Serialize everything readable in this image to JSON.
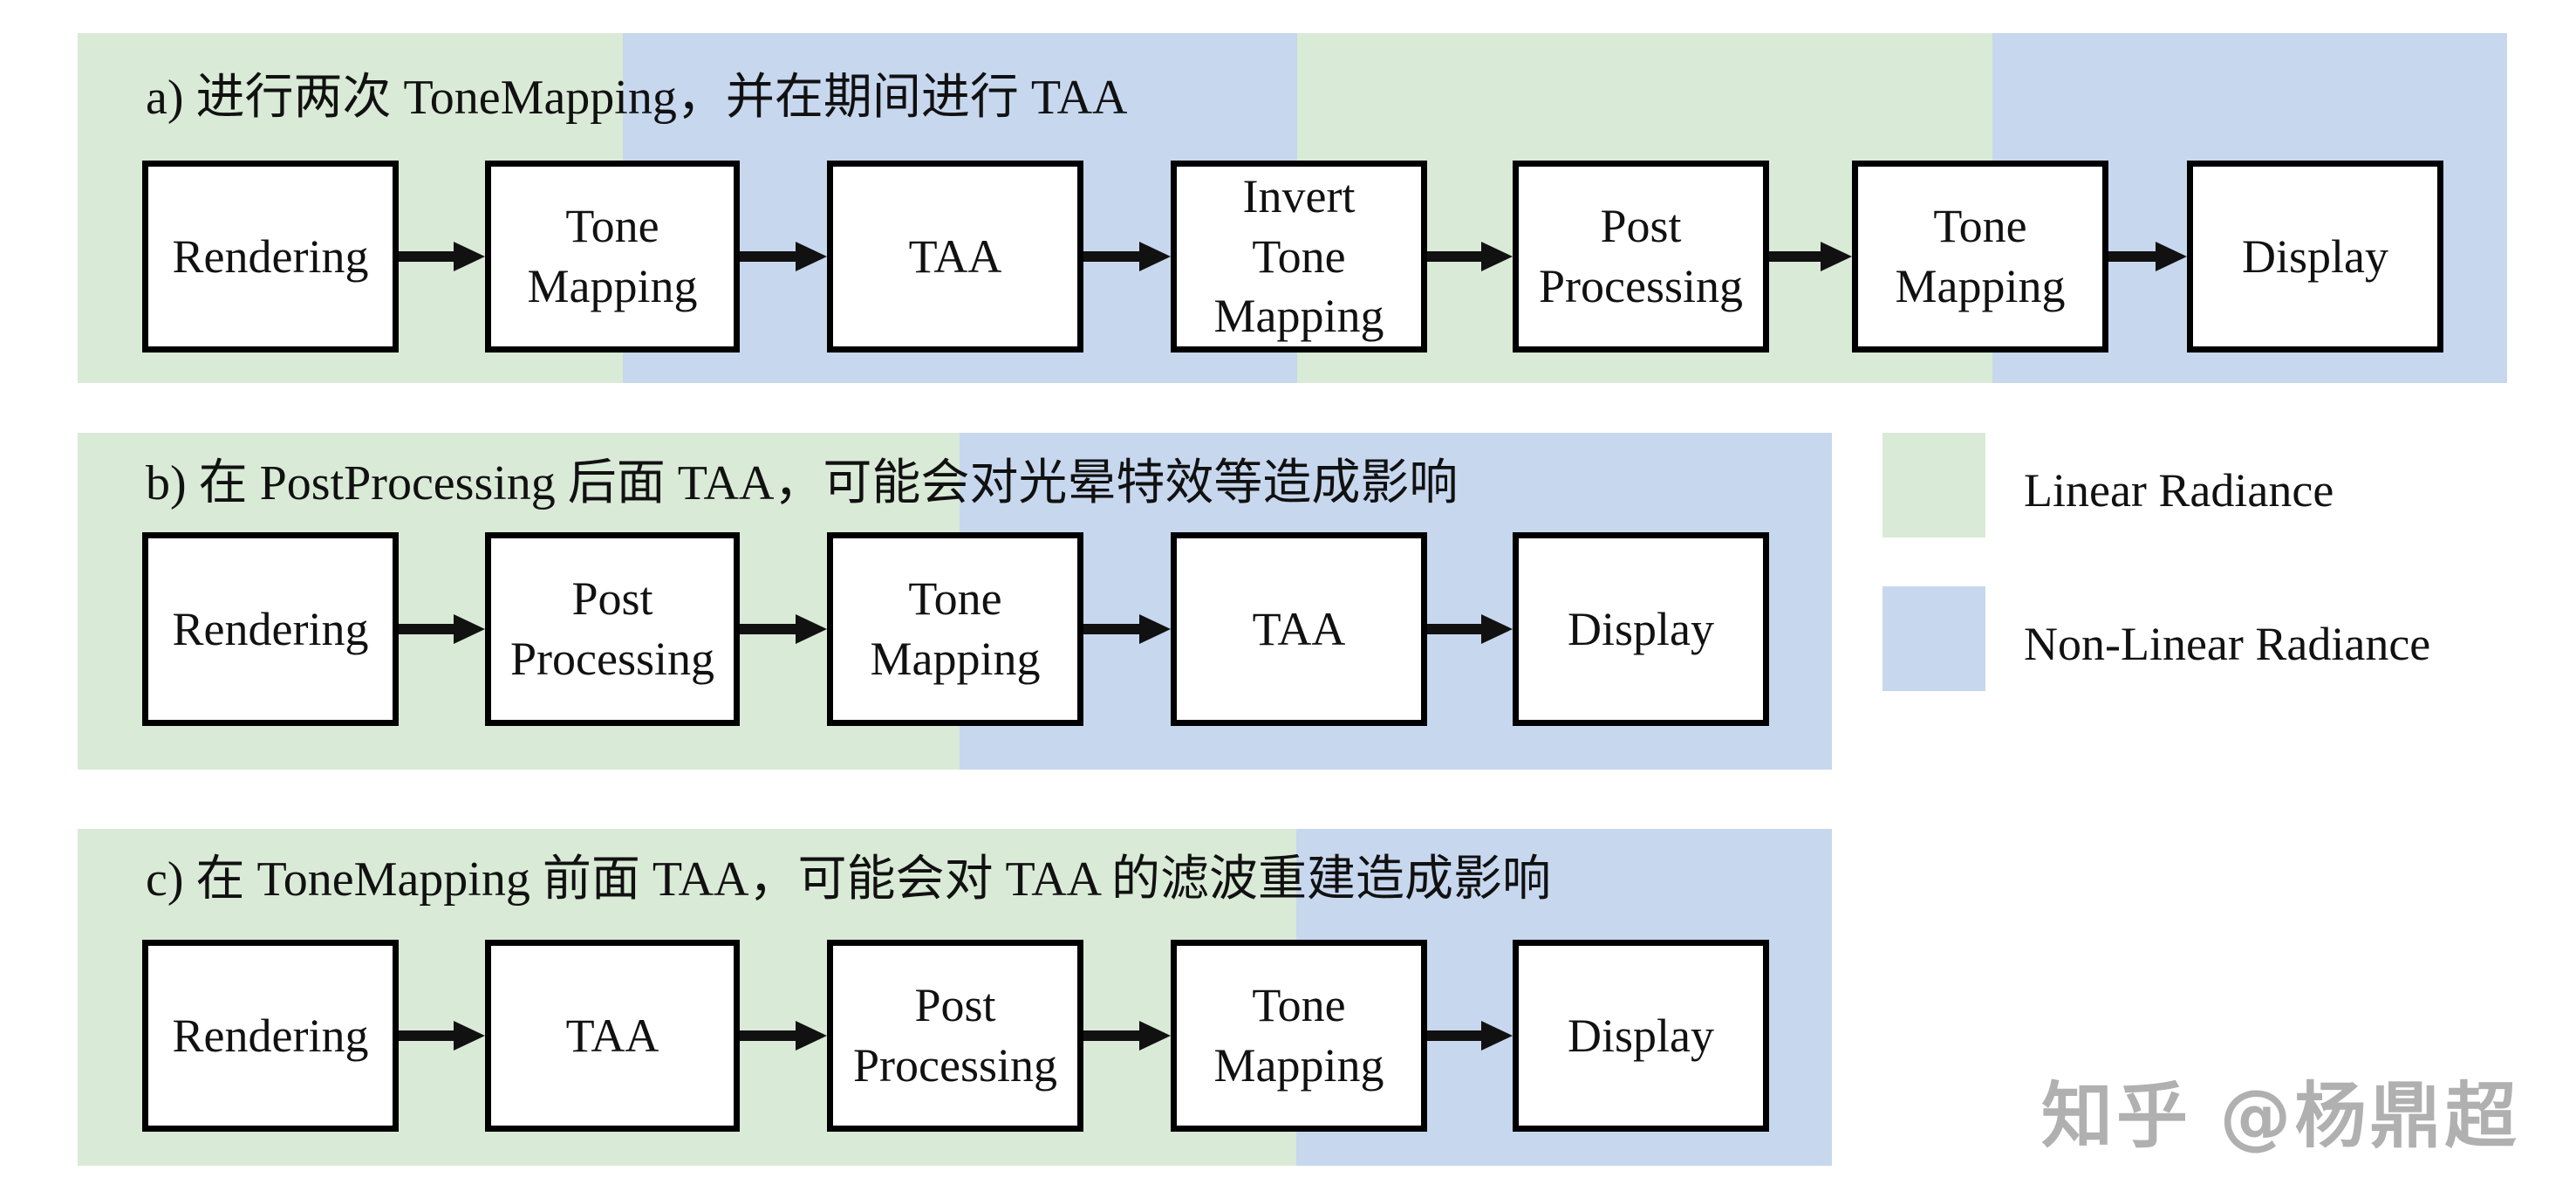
{
  "colors": {
    "linear": "#d9ead6",
    "non_linear": "#c7d7ee"
  },
  "legend": [
    {
      "key": "linear",
      "label": "Linear Radiance"
    },
    {
      "key": "non_linear",
      "label": "Non-Linear Radiance"
    }
  ],
  "panels": [
    {
      "id": "a",
      "title": "a) 进行两次 ToneMapping，并在期间进行 TAA",
      "bands": [
        "linear",
        "non_linear",
        "linear",
        "non_linear"
      ],
      "boxes": [
        "Rendering",
        "Tone\nMapping",
        "TAA",
        "Invert\nTone\nMapping",
        "Post\nProcessing",
        "Tone\nMapping",
        "Display"
      ]
    },
    {
      "id": "b",
      "title": "b) 在 PostProcessing 后面 TAA，可能会对光晕特效等造成影响",
      "bands": [
        "linear",
        "non_linear"
      ],
      "boxes": [
        "Rendering",
        "Post\nProcessing",
        "Tone\nMapping",
        "TAA",
        "Display"
      ]
    },
    {
      "id": "c",
      "title": "c) 在 ToneMapping 前面 TAA，可能会对 TAA 的滤波重建造成影响",
      "bands": [
        "linear",
        "non_linear"
      ],
      "boxes": [
        "Rendering",
        "TAA",
        "Post\nProcessing",
        "Tone\nMapping",
        "Display"
      ]
    }
  ],
  "watermark": "知乎 @杨鼎超"
}
